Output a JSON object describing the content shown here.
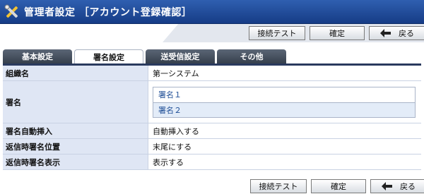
{
  "header": {
    "title": "管理者設定 ［アカウント登録確認］",
    "icon": "tools-icon"
  },
  "buttons": {
    "test": "接続テスト",
    "confirm": "確定",
    "back": "戻る"
  },
  "tabs": [
    {
      "label": "基本設定",
      "active": false
    },
    {
      "label": "署名設定",
      "active": true
    },
    {
      "label": "送受信設定",
      "active": false
    },
    {
      "label": "その他",
      "active": false
    }
  ],
  "fields": {
    "org_name": {
      "label": "組織名",
      "value": "第一システム"
    },
    "signature": {
      "label": "署名",
      "items": [
        "署名１",
        "署名２"
      ],
      "selected": 1
    },
    "auto_insert": {
      "label": "署名自動挿入",
      "value": "自動挿入する"
    },
    "reply_position": {
      "label": "返信時署名位置",
      "value": "末尾にする"
    },
    "reply_display": {
      "label": "返信時署名表示",
      "value": "表示する"
    }
  },
  "colors": {
    "header": "#1f4a9a",
    "label_bg": "#dfe6f4",
    "tab": "#4a5563",
    "selected_item": "#e3ecf8"
  }
}
